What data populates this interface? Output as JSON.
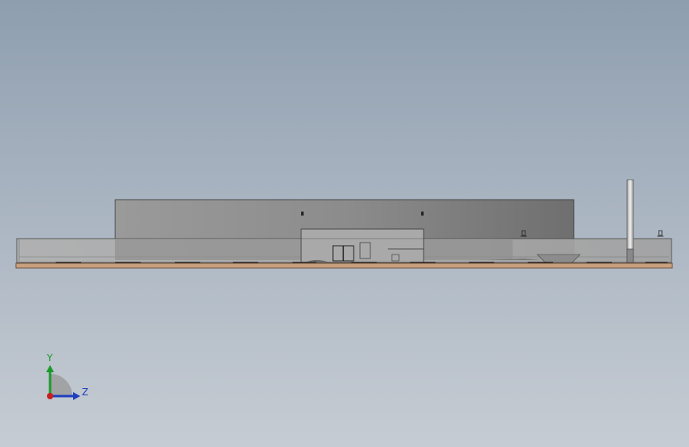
{
  "viewport": {
    "background": "#a4afbc",
    "model": {
      "ground_color": "#c9a07f",
      "building_color": "#8b8b8b",
      "wall_color": "#a6a6a6",
      "chimney_color": "#d9d9d9"
    }
  },
  "triad": {
    "y_axis": {
      "label": "Y",
      "color": "#1a9a2a"
    },
    "z_axis": {
      "label": "Z",
      "color": "#1f3fbf"
    },
    "x_axis": {
      "color": "#c81e1e"
    }
  }
}
